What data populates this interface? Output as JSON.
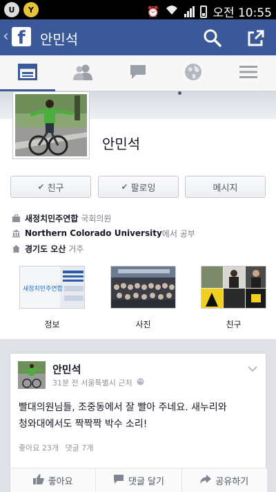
{
  "status_bar": {
    "time_label": "오전 10:55",
    "left_icons": [
      "U",
      "Y"
    ]
  },
  "header": {
    "back_glyph": "‹",
    "logo_letter": "f",
    "title": "안민석",
    "icons": [
      "search-icon",
      "share-icon"
    ],
    "bg_color": "#3b5998"
  },
  "tabs": [
    {
      "icon": "timeline-icon",
      "active": true
    },
    {
      "icon": "friends-icon",
      "active": false
    },
    {
      "icon": "messages-icon",
      "active": false
    },
    {
      "icon": "globe-icon",
      "active": false
    },
    {
      "icon": "menu-icon",
      "active": false
    }
  ],
  "profile": {
    "name": "안민석",
    "buttons": {
      "friend": {
        "check": "✔",
        "label": "친구"
      },
      "follow": {
        "check": "✔",
        "label": "팔로잉"
      },
      "message": {
        "label": "메시지"
      }
    },
    "info": {
      "work_org": "새정치민주연합",
      "work_role": "국회의원",
      "school": "Northern Colorado University",
      "school_suffix": "에서 공부",
      "city": "경기도 오산",
      "city_suffix": "거주"
    },
    "tiles": [
      {
        "label": "정보",
        "image_text": "새정치민주연합"
      },
      {
        "label": "사진"
      },
      {
        "label": "친구"
      }
    ]
  },
  "post": {
    "author": "안민석",
    "meta": "31분 전 서울특별시 근처",
    "body_line1": "빨대의원님들, 조중동에서 잘 빨아 주네요. 새누리와",
    "body_line2": "청와대에서도 짝짝짝 박수 소리!",
    "likes": "좋아요 23개",
    "comments": "댓글 7개",
    "actions": {
      "like": "좋아요",
      "comment": "댓글 달기",
      "share": "공유하기"
    }
  }
}
